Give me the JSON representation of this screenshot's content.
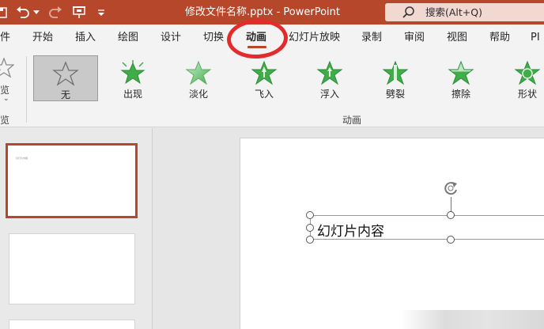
{
  "titlebar": {
    "doc_title": "修改文件名称.pptx",
    "separator": " - ",
    "app_name": "PowerPoint",
    "search_label": "搜索(Alt+Q)",
    "quick_access": [
      {
        "name": "save-icon"
      },
      {
        "name": "undo-icon"
      },
      {
        "name": "dropdown-caret-icon"
      },
      {
        "name": "redo-icon"
      },
      {
        "name": "present-from-start-icon"
      },
      {
        "name": "customize-quick-access-icon"
      }
    ],
    "bg_color": "#b7472a"
  },
  "tabs": [
    {
      "label": "件",
      "active": false
    },
    {
      "label": "开始",
      "active": false
    },
    {
      "label": "插入",
      "active": false
    },
    {
      "label": "绘图",
      "active": false
    },
    {
      "label": "设计",
      "active": false
    },
    {
      "label": "切换",
      "active": false
    },
    {
      "label": "动画",
      "active": true
    },
    {
      "label": "幻灯片放映",
      "active": false
    },
    {
      "label": "录制",
      "active": false
    },
    {
      "label": "审阅",
      "active": false
    },
    {
      "label": "视图",
      "active": false
    },
    {
      "label": "帮助",
      "active": false
    },
    {
      "label": "PI",
      "active": false
    }
  ],
  "ribbon": {
    "preview_label_top": "览",
    "preview_label_bottom": "览",
    "group_label": "动画",
    "animations": [
      {
        "label": "无",
        "selected": true,
        "icon": "star-outline-icon"
      },
      {
        "label": "出现",
        "selected": false,
        "icon": "star-burst-icon"
      },
      {
        "label": "淡化",
        "selected": false,
        "icon": "star-fade-icon"
      },
      {
        "label": "飞入",
        "selected": false,
        "icon": "star-fly-in-icon"
      },
      {
        "label": "浮入",
        "selected": false,
        "icon": "star-float-in-icon"
      },
      {
        "label": "劈裂",
        "selected": false,
        "icon": "star-split-icon"
      },
      {
        "label": "擦除",
        "selected": false,
        "icon": "star-wipe-icon"
      },
      {
        "label": "形状",
        "selected": false,
        "icon": "star-shape-icon"
      }
    ],
    "star_color": "#3fae49"
  },
  "thumbnails": [
    {
      "text": "幻灯片内容",
      "selected": true
    },
    {
      "text": "",
      "selected": false
    },
    {
      "text": "",
      "selected": false
    }
  ],
  "slide": {
    "textbox_text": "幻灯片内容"
  },
  "annotation": {
    "circle_color": "#e42a2a"
  }
}
